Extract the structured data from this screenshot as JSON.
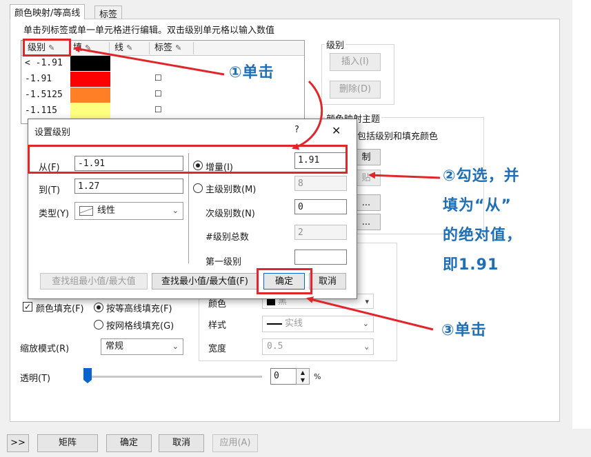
{
  "tabs": [
    {
      "label": "颜色映射/等高线"
    },
    {
      "label": "标签"
    }
  ],
  "hint": "单击列标签或单一单元格进行编辑。双击级别单元格以输入数值",
  "grid": {
    "headers": [
      "级别",
      "填",
      "线",
      "标签"
    ],
    "rows": [
      {
        "level": "< -1.91",
        "color": "#000000",
        "label_check": ""
      },
      {
        "level": "-1.91",
        "color": "#ff0000",
        "label_check": "☐"
      },
      {
        "level": "-1.5125",
        "color": "#ff7f27",
        "label_check": "☐"
      },
      {
        "level": "-1.115",
        "color": "#ffff7f",
        "label_check": "☐"
      }
    ]
  },
  "level_group": {
    "title": "级别",
    "insert": "插入(I)",
    "delete": "删除(D)"
  },
  "theme_group": {
    "title": "颜色映射主题",
    "desc": "包括级别和填充颜色",
    "btn1": "制",
    "btn2": "贴",
    "btn3": "...",
    "btn4": "..."
  },
  "fill": {
    "color_fill": "颜色填充(F)",
    "by_contour": "按等高线填充(F)",
    "by_grid": "按网格线填充(G)",
    "color_fill_checked": "✓"
  },
  "scale": {
    "label": "缩放模式(R)",
    "value": "常规"
  },
  "transparency": {
    "label": "透明(T)",
    "value": "0",
    "unit": "%"
  },
  "line_props": {
    "color_label": "颜色",
    "color_value": "黑",
    "style_label": "样式",
    "style_value": "实线",
    "width_label": "宽度",
    "width_value": "0.5"
  },
  "dialog": {
    "title": "设置级别",
    "help": "?",
    "close": "✕",
    "from_label": "从(F)",
    "from_value": "-1.91",
    "to_label": "到(T)",
    "to_value": "1.27",
    "type_label": "类型(Y)",
    "type_value": "线性",
    "increment_label": "增量(I)",
    "increment_value": "1.91",
    "major_label": "主级别数(M)",
    "major_value": "8",
    "minor_label": "次级别数(N)",
    "minor_value": "0",
    "total_label": "#级别总数",
    "total_value": "2",
    "first_label": "第一级别",
    "first_value": "",
    "find_group_btn": "查找组最小值/最大值",
    "find_btn": "查找最小值/最大值(F)",
    "ok_btn": "确定",
    "cancel_btn": "取消"
  },
  "bottom": {
    "expand": ">>",
    "matrix": "矩阵",
    "ok": "确定",
    "cancel": "取消",
    "apply": "应用(A)"
  },
  "annotations": {
    "step1": "①单击",
    "step2_l1": "②勾选，并",
    "step2_l2": "填为“从”",
    "step2_l3": "的绝对值，",
    "step2_l4": "即1.91",
    "step3": "③单击",
    "highlight_color": "#e0262a",
    "text_color": "#1f6fb7"
  }
}
